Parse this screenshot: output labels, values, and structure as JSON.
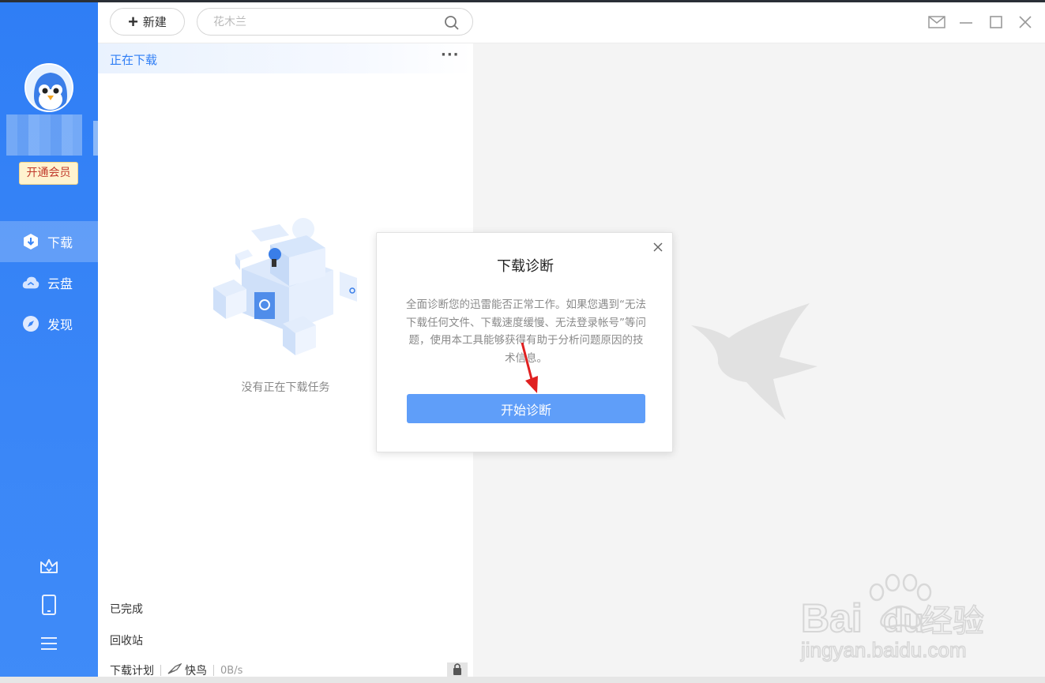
{
  "toolbar": {
    "new_label": "新建",
    "search_placeholder": "花木兰"
  },
  "sidebar": {
    "vip_label": "开通会员",
    "items": [
      {
        "label": "下载",
        "icon": "download-icon",
        "active": true
      },
      {
        "label": "云盘",
        "icon": "cloud-icon",
        "active": false
      },
      {
        "label": "发现",
        "icon": "compass-icon",
        "active": false
      }
    ],
    "bottom_icons": [
      "crown-icon",
      "phone-icon",
      "menu-icon"
    ]
  },
  "list": {
    "tab_label": "正在下载",
    "more_label": "···",
    "empty_text": "没有正在下载任务",
    "completed_label": "已完成",
    "recycle_label": "回收站",
    "plan_label": "下载计划",
    "kuainiao_label": "快鸟",
    "speed": "0B/s"
  },
  "dialog": {
    "title": "下载诊断",
    "description": "全面诊断您的迅雷能否正常工作。如果您遇到“无法下载任何文件、下载速度缓慢、无法登录帐号”等问题，使用本工具能够获得有助于分析问题原因的技术信息。",
    "button_label": "开始诊断"
  },
  "colors": {
    "sidebar_blue": "#2f7ef5",
    "accent_blue": "#2f7ef5",
    "button_blue": "#5f9ef9",
    "vip_text": "#c0392b",
    "arrow_red": "#e02020"
  }
}
